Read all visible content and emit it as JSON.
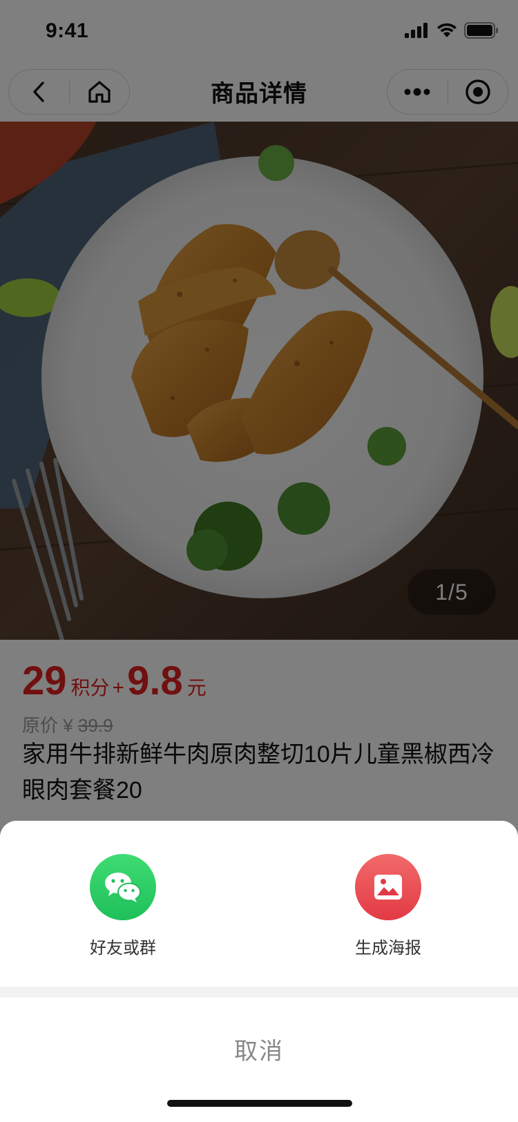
{
  "status_bar": {
    "time": "9:41"
  },
  "nav": {
    "title": "商品详情"
  },
  "product": {
    "image_counter": "1/5",
    "price_points": "29",
    "points_unit": "积分",
    "plus": "+",
    "price_cash": "9.8",
    "cash_unit": "元",
    "original_label": "原价 ¥",
    "original_price": "39.9",
    "title": "家用牛排新鲜牛肉原肉整切10片儿童黑椒西冷眼肉套餐20"
  },
  "share_sheet": {
    "options": [
      {
        "label": "好友或群",
        "icon": "wechat-icon",
        "color": "#1fbf5a"
      },
      {
        "label": "生成海报",
        "icon": "image-icon",
        "color": "#e23a45"
      }
    ],
    "cancel_label": "取消"
  },
  "colors": {
    "price": "#e02020"
  }
}
